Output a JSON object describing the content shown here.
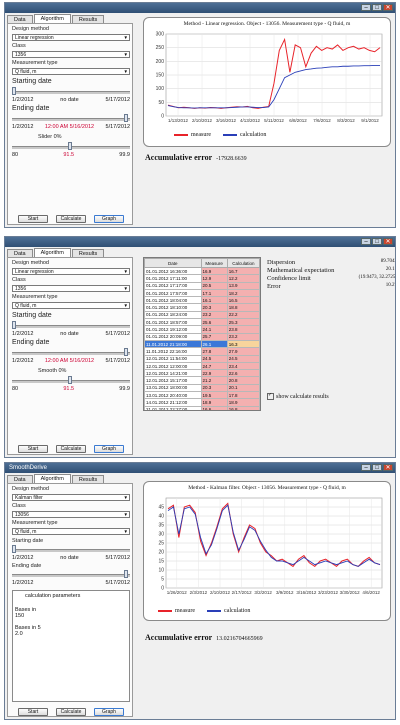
{
  "w1": {
    "tabs": [
      "Data",
      "Algorithm",
      "Results"
    ],
    "design_method_label": "Design method",
    "design_method_value": "Linear regression",
    "class_label": "Class",
    "class_value": "1356",
    "measurement_type_label": "Measurement type",
    "measurement_type_value": "Q fluid, m",
    "starting_date_label": "Starting date",
    "start_date": "1/2/2012",
    "no_date": "no date",
    "end_date": "5/17/2012",
    "ending_date_label": "Ending date",
    "ending_from": "1/2/2012",
    "ending_mid": "12:00 AM 5/16/2012",
    "ending_to": "5/17/2012",
    "sliders_label": "Slider 0%",
    "slider_min": "80",
    "slider_mid": "91.5",
    "slider_max": "99.9",
    "buttons": [
      "Start",
      "Calculate",
      "Graph"
    ],
    "chart_title": "Method - Linear regression. Object - 13056. Measurement type - Q fluid, m",
    "legend": [
      "measure",
      "calculation"
    ],
    "accum_label": "Accumulative error",
    "accum_value": "-17928.6639"
  },
  "w2": {
    "tabs": [
      "Data",
      "Algorithm",
      "Results"
    ],
    "design_method_label": "Design method",
    "design_method_value": "Linear regression",
    "class_label": "Class",
    "class_value": "1356",
    "measurement_type_label": "Measurement type",
    "measurement_type_value": "Q fluid, m",
    "starting_date_label": "Starting date",
    "start_date": "1/2/2012",
    "no_date": "no date",
    "end_date": "5/17/2012",
    "ending_date_label": "Ending date",
    "ending_from": "1/2/2012",
    "ending_mid": "12:00 AM 5/16/2012",
    "ending_to": "5/17/2012",
    "sliders_label": "Smooth 0%",
    "slider_min": "80",
    "slider_mid": "91.5",
    "slider_max": "99.9",
    "buttons": [
      "Start",
      "Calculate",
      "Graph"
    ],
    "grid_headers": [
      "Date",
      "Measure",
      "Calculation"
    ],
    "grid_rows": [
      [
        "01.01.2012 16:36:00",
        "16.9",
        "16.7"
      ],
      [
        "01.01.2012 17:11:00",
        "12.9",
        "12.2"
      ],
      [
        "01.01.2012 17:17:00",
        "20.5",
        "13.9"
      ],
      [
        "01.01.2012 17:57:00",
        "17.1",
        "18.2"
      ],
      [
        "01.01.2012 18:04:00",
        "16.1",
        "16.5"
      ],
      [
        "01.01.2012 18:10:00",
        "20.3",
        "18.8"
      ],
      [
        "01.01.2012 18:24:00",
        "23.2",
        "22.2"
      ],
      [
        "01.01.2012 18:57:00",
        "25.6",
        "25.3"
      ],
      [
        "01.01.2012 19:12:00",
        "24.1",
        "23.8"
      ],
      [
        "01.01.2012 20:09:00",
        "25.7",
        "23.2"
      ],
      [
        "11.01.2012 21:18:00",
        "26.1",
        "16.3"
      ],
      [
        "11.01.2012 22:16:00",
        "27.8",
        "27.9"
      ],
      [
        "12.01.2012 11:54:00",
        "24.5",
        "24.5"
      ],
      [
        "12.01.2012 12:00:00",
        "24.7",
        "23.4"
      ],
      [
        "12.01.2012 14:21:00",
        "22.9",
        "22.6"
      ],
      [
        "12.01.2012 15:17:00",
        "21.2",
        "20.8"
      ],
      [
        "13.01.2012 18:00:00",
        "20.3",
        "20.1"
      ],
      [
        "13.01.2012 20:40:00",
        "19.5",
        "17.8"
      ],
      [
        "14.01.2012 21:12:00",
        "18.9",
        "18.9"
      ],
      [
        "21.01.2012 22:27:00",
        "16.6",
        "16.8"
      ],
      [
        "21.01.2012 22:27:00",
        "17.1",
        "17.9"
      ],
      [
        "21.01.2012 23:34:00",
        "17.8",
        "17.2"
      ]
    ],
    "stats": [
      [
        "Dispersion",
        "89.7043"
      ],
      [
        "Mathematical expectation",
        "20.11"
      ],
      [
        "Confidence limit",
        "(19.9473, 32.2725)"
      ],
      [
        "Error",
        "10.27"
      ]
    ],
    "show_calc_label": "show calculate results"
  },
  "w3": {
    "title": "SmoothDerive",
    "tabs": [
      "Data",
      "Algorithm",
      "Results"
    ],
    "design_method_label": "Design method",
    "design_method_value": "Kalman filter",
    "class_label": "Class",
    "class_value": "13056",
    "measurement_type_label": "Measurement type",
    "measurement_type_value": "Q fluid, m",
    "starting_date_label": "Starting date",
    "start_date": "1/2/2012",
    "no_date": "no date",
    "end_date": "5/17/2012",
    "ending_date_label": "Ending date",
    "ending_from": "1/2/2012",
    "ending_to": "5/17/2012",
    "params_label": "calculation parameters",
    "param1_label": "Bases in",
    "param1_value": "150",
    "param2_label": "Bases in 5",
    "param2_value": "2.0",
    "buttons": [
      "Start",
      "Calculate",
      "Graph"
    ],
    "chart_title": "Method - Kalman filter. Object - 13056. Measurement type - Q fluid, m",
    "legend": [
      "measure",
      "calculation"
    ],
    "accum_label": "Accumulative error",
    "accum_value": "13.0216704665969"
  },
  "colors": {
    "measure": "#e8232a",
    "calculation": "#2a3fb8",
    "accent": "#2f4f74"
  },
  "chart_data": [
    {
      "type": "line",
      "title": "Method - Linear regression. Object - 13056. Measurement type - Q fluid, m",
      "ylim": [
        0,
        300
      ],
      "yticks": [
        "300",
        "250",
        "200",
        "150",
        "100",
        "50",
        "0"
      ],
      "xticks": [
        "1/13/2012",
        "2/10/2012",
        "3/16/2012",
        "4/13/2012",
        "5/11/2012",
        "6/8/2012",
        "7/6/2012",
        "8/3/2012",
        "9/1/2012"
      ],
      "x": [
        0,
        1,
        2,
        3,
        4,
        5,
        6,
        7,
        8,
        9,
        10,
        11,
        12,
        13,
        14,
        15,
        16,
        17,
        18,
        19,
        20,
        21,
        22,
        23,
        24,
        25,
        26,
        27,
        28,
        29,
        30,
        31,
        32,
        33,
        34,
        35,
        36,
        37,
        38,
        39,
        40
      ],
      "series": [
        {
          "name": "measure",
          "values": [
            40,
            35,
            30,
            32,
            30,
            28,
            30,
            29,
            31,
            30,
            28,
            30,
            32,
            34,
            33,
            35,
            30,
            28,
            32,
            35,
            120,
            240,
            280,
            160,
            260,
            250,
            180,
            230,
            255,
            240,
            250,
            245,
            260,
            240,
            250,
            255,
            245,
            250,
            240,
            235,
            250
          ]
        },
        {
          "name": "calculation",
          "values": [
            38,
            34,
            31,
            30,
            30,
            29,
            30,
            30,
            30,
            30,
            30,
            30,
            31,
            32,
            33,
            33,
            32,
            31,
            31,
            33,
            60,
            100,
            140,
            150,
            160,
            165,
            170,
            172,
            175,
            176,
            178,
            180,
            180,
            182,
            182,
            183,
            183,
            184,
            184,
            185,
            185
          ]
        }
      ]
    },
    {
      "type": "line",
      "title": "Method - Kalman filter. Object - 13056. Measurement type - Q fluid, m",
      "ylim": [
        0,
        50
      ],
      "yticks": [
        "45",
        "40",
        "35",
        "30",
        "25",
        "20",
        "15",
        "10",
        "5",
        "0"
      ],
      "xticks": [
        "1/26/2012",
        "2/3/2012",
        "2/10/2012",
        "2/17/2012",
        "3/2/2012",
        "3/9/2012",
        "3/16/2012",
        "3/23/2012",
        "3/30/2012",
        "4/6/2012"
      ],
      "x": [
        0,
        1,
        2,
        3,
        4,
        5,
        6,
        7,
        8,
        9,
        10,
        11,
        12,
        13,
        14,
        15,
        16,
        17,
        18,
        19,
        20,
        21,
        22,
        23,
        24,
        25,
        26,
        27,
        28,
        29,
        30,
        31,
        32,
        33,
        34,
        35,
        36,
        37,
        38,
        39
      ],
      "series": [
        {
          "name": "measure",
          "values": [
            44,
            46,
            28,
            45,
            46,
            42,
            26,
            18,
            25,
            34,
            44,
            47,
            30,
            20,
            28,
            35,
            33,
            25,
            20,
            18,
            15,
            16,
            14,
            12,
            16,
            18,
            14,
            12,
            15,
            16,
            14,
            12,
            15,
            16,
            13,
            12,
            15,
            17,
            14,
            13
          ]
        },
        {
          "name": "calculation",
          "values": [
            43,
            45,
            30,
            44,
            45,
            41,
            28,
            19,
            24,
            33,
            43,
            46,
            31,
            21,
            27,
            34,
            32,
            26,
            21,
            17,
            15,
            15,
            14,
            13,
            15,
            17,
            15,
            13,
            14,
            15,
            14,
            13,
            14,
            15,
            13,
            12,
            14,
            16,
            14,
            13
          ]
        }
      ]
    }
  ]
}
